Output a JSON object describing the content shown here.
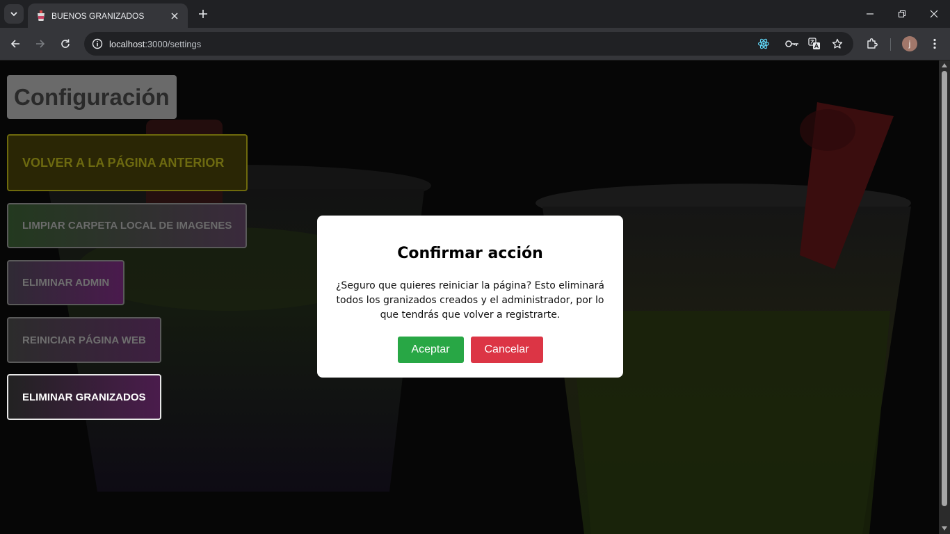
{
  "browser": {
    "tab_title": "BUENOS GRANIZADOS",
    "url_host": "localhost",
    "url_path": ":3000/settings",
    "profile_initial": "j",
    "icons": [
      "tab-search-icon",
      "favicon-cup-icon",
      "close-icon",
      "plus-icon",
      "minimize-icon",
      "restore-icon",
      "close-window-icon",
      "back-icon",
      "forward-icon",
      "reload-icon",
      "info-icon",
      "react-devtools-icon",
      "key-icon",
      "translate-icon",
      "star-icon",
      "extensions-icon",
      "more-vert-icon"
    ]
  },
  "page": {
    "title": "Configuración",
    "buttons": {
      "volver": "VOLVER A LA PÁGINA ANTERIOR",
      "limpiar": "LIMPIAR CARPETA LOCAL DE IMAGENES",
      "eliminar_admin": "ELIMINAR ADMIN",
      "reiniciar": "REINICIAR PÁGINA WEB",
      "eliminar_granizados": "ELIMINAR GRANIZADOS"
    }
  },
  "modal": {
    "title": "Confirmar acción",
    "message": "¿Seguro que quieres reiniciar la página? Esto eliminará todos los granizados creados y el administrador, por lo que tendrás que volver a registrarte.",
    "accept_label": "Aceptar",
    "cancel_label": "Cancelar"
  },
  "colors": {
    "accept": "#28a745",
    "cancel": "#dc3545",
    "chrome_dark": "#202124",
    "chrome_toolbar": "#35363a"
  }
}
